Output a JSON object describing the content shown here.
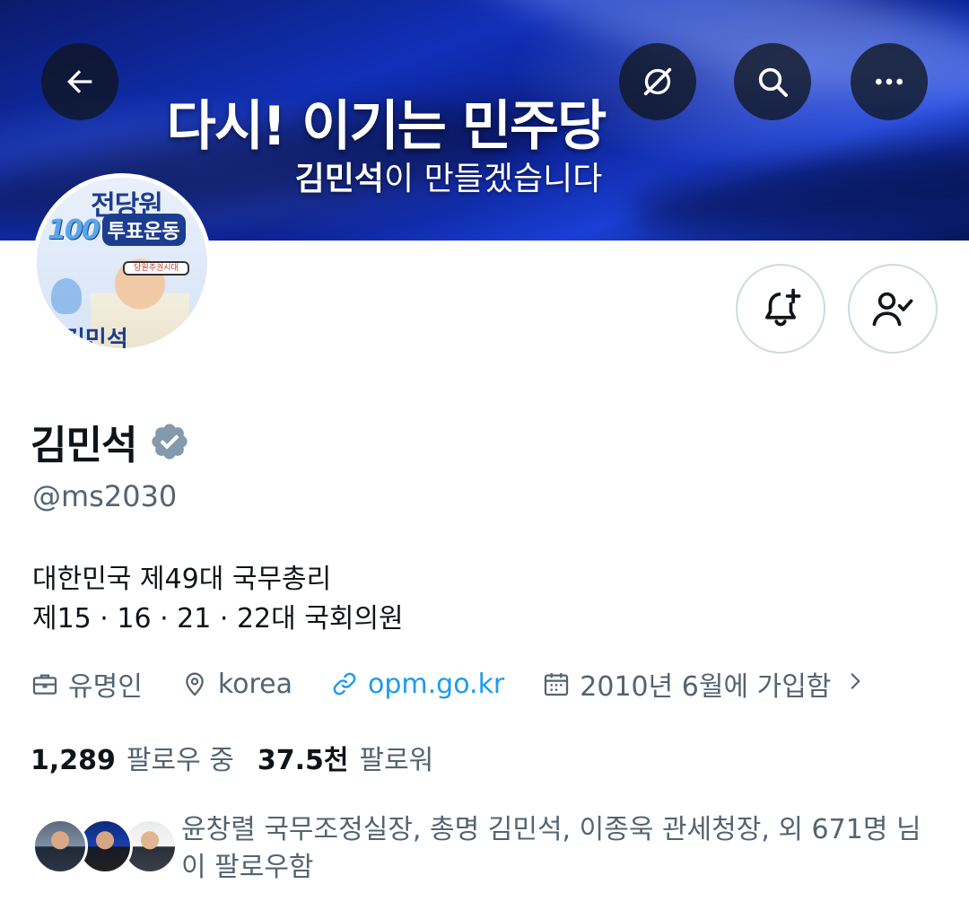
{
  "banner": {
    "headline": "다시! 이기는 민주당",
    "sub_name": "김민석",
    "sub_rest": "이 만들겠습니다"
  },
  "nav": {
    "back_icon": "arrow-left-icon",
    "grok_icon": "grok-icon",
    "search_icon": "search-icon",
    "more_icon": "more-horizontal-icon"
  },
  "avatar": {
    "top_text": "전당원",
    "number_text": "100",
    "vote_text": "투표운동",
    "band_text": "당원주권시대",
    "name_text": "김민석"
  },
  "actions": {
    "notify_icon": "bell-plus-icon",
    "following_icon": "person-check-icon"
  },
  "profile": {
    "name": "김민석",
    "verified_icon": "verified-badge-icon",
    "handle": "@ms2030",
    "bio_line1": "대한민국 제49대 국무총리",
    "bio_line2": "제15 · 16 · 21 · 22대 국회의원",
    "category": "유명인",
    "location": "korea",
    "website": "opm.go.kr",
    "joined": "2010년 6월에 가입함"
  },
  "stats": {
    "following_count": "1,289",
    "following_label": "팔로우 중",
    "followers_count": "37.5천",
    "followers_label": "팔로워"
  },
  "followed_by": {
    "text": "윤창렬 국무조정실장, 총명 김민석, 이종욱 관세청장, 외 671명 님이 팔로우함"
  },
  "colors": {
    "link": "#1d9bf0",
    "secondary_text": "#536471",
    "primary_text": "#0f1419",
    "verified": "#829aab"
  }
}
